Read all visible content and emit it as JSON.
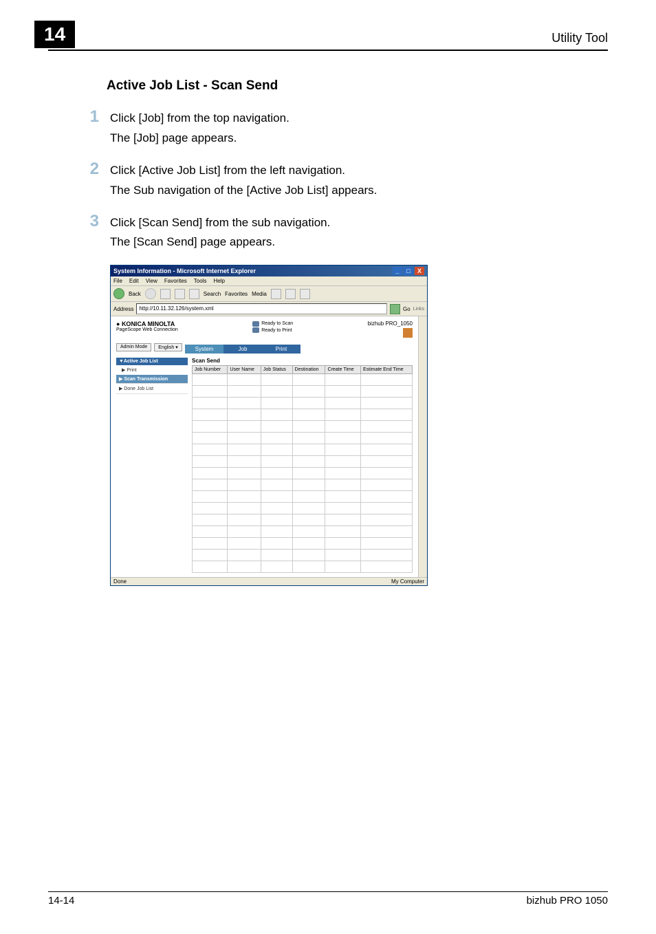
{
  "header": {
    "chapter": "14",
    "title": "Utility Tool"
  },
  "section_title": "Active Job List - Scan Send",
  "steps": [
    {
      "num": "1",
      "line1": "Click [Job] from the top navigation.",
      "line2": "The [Job] page appears."
    },
    {
      "num": "2",
      "line1": "Click [Active Job List] from the left navigation.",
      "line2": "The Sub navigation of the [Active Job List] appears."
    },
    {
      "num": "3",
      "line1": "Click [Scan Send] from the sub navigation.",
      "line2": "The [Scan Send] page appears."
    }
  ],
  "ie": {
    "title": "System Information - Microsoft Internet Explorer",
    "menus": [
      "File",
      "Edit",
      "View",
      "Favorites",
      "Tools",
      "Help"
    ],
    "toolbar": {
      "back": "Back",
      "search": "Search",
      "favorites": "Favorites",
      "media": "Media"
    },
    "address_label": "Address",
    "address": "http://10.11.32.126/system.xml",
    "go": "Go",
    "links": "Links",
    "brand": "KONICA MINOLTA",
    "subbrand": "PageScope Web Connection",
    "ready_scan": "Ready to Scan",
    "ready_print": "Ready to Print",
    "device": "bizhub PRO_1050",
    "mode_admin": "Admin Mode",
    "mode_lang": "English",
    "tabs": {
      "system": "System",
      "job": "Job",
      "print": "Print"
    },
    "leftnav": {
      "active": "▼Active Job List",
      "print": "▶ Print",
      "scan": "▶ Scan Transmission",
      "done": "▶ Done Job List"
    },
    "table_title": "Scan Send",
    "columns": [
      "Job Number",
      "User Name",
      "Job Status",
      "Destination",
      "Create Time",
      "Estimate End Time"
    ],
    "status_done": "Done",
    "status_zone": "My Computer"
  },
  "footer": {
    "left": "14-14",
    "right": "bizhub PRO 1050"
  }
}
